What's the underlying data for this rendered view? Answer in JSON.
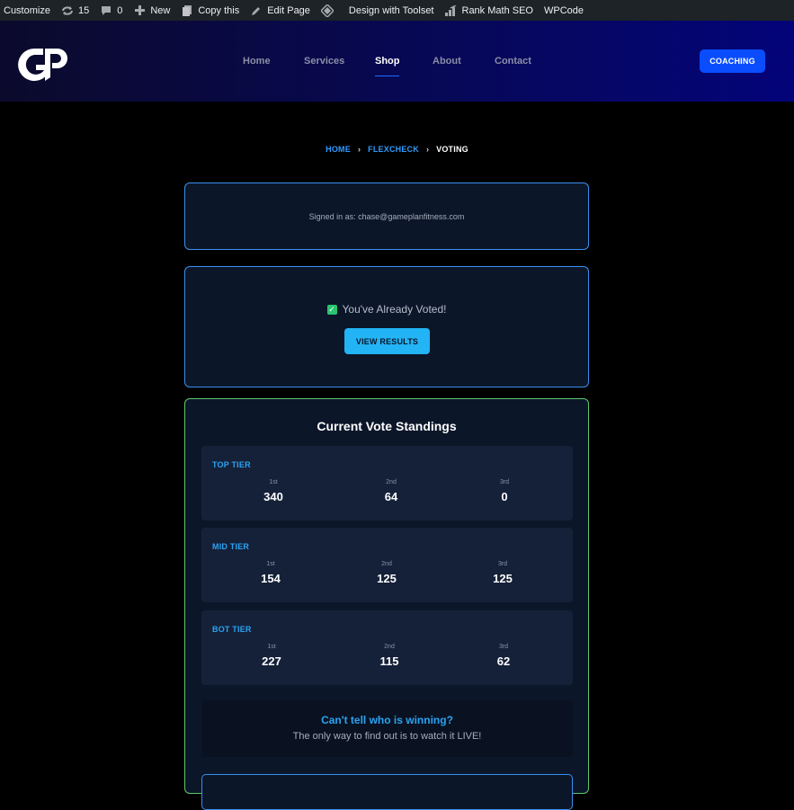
{
  "adminbar": {
    "customize": "Customize",
    "updates": "15",
    "comments": "0",
    "new": "New",
    "copy": "Copy this",
    "edit": "Edit Page",
    "toolset": "Design with Toolset",
    "rankmath": "Rank Math SEO",
    "wpcode": "WPCode"
  },
  "header": {
    "nav": [
      "Home",
      "Services",
      "Shop",
      "About",
      "Contact"
    ],
    "active": "Shop",
    "cta": "COACHING"
  },
  "breadcrumb": {
    "items": [
      "HOME",
      "FLEXCHECK",
      "VOTING"
    ]
  },
  "signed_in": "Signed in as: chase@gameplanfitness.com",
  "voted": {
    "message": "You've Already Voted!",
    "button": "VIEW RESULTS"
  },
  "standings": {
    "title": "Current Vote Standings",
    "tiers": [
      {
        "name": "TOP TIER",
        "places": [
          "1st",
          "2nd",
          "3rd"
        ],
        "values": [
          "340",
          "64",
          "0"
        ]
      },
      {
        "name": "MID TIER",
        "places": [
          "1st",
          "2nd",
          "3rd"
        ],
        "values": [
          "154",
          "125",
          "125"
        ]
      },
      {
        "name": "BOT TIER",
        "places": [
          "1st",
          "2nd",
          "3rd"
        ],
        "values": [
          "227",
          "115",
          "62"
        ]
      }
    ],
    "promo_heading": "Can't tell who is winning?",
    "promo_text": "The only way to find out is to watch it LIVE!"
  },
  "colors": {
    "accent": "#2aa3f2",
    "cta": "#0a4dff",
    "success": "#29c46f",
    "standings_border": "#5ec96a"
  }
}
